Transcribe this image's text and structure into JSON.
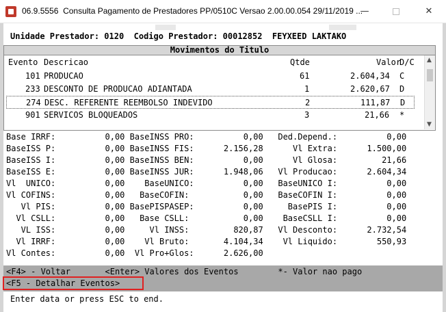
{
  "window": {
    "version": "06.9.5556",
    "title": "Consulta  Pagamento de Prestadores PP/0510C Versao 2.00.00.054 29/11/2019 ..."
  },
  "header": {
    "line": "Unidade Prestador: 0120  Codigo Prestador: 00012852  FEYXEED LAKTAKO"
  },
  "movements": {
    "title": "Movimentos do Titulo",
    "columns": {
      "evento": "Evento",
      "descricao": "Descricao",
      "qtde": "Qtde",
      "valor": "Valor",
      "dc": "D/C"
    },
    "rows": [
      {
        "evento": "101",
        "descricao": "PRODUCAO",
        "qtde": "61",
        "valor": "2.604,34",
        "dc": "C"
      },
      {
        "evento": "233",
        "descricao": "DESCONTO DE PRODUCAO ADIANTADA",
        "qtde": "1",
        "valor": "2.620,67",
        "dc": "D"
      },
      {
        "evento": "274",
        "descricao": "DESC. REFERENTE REEMBOLSO INDEVIDO",
        "qtde": "2",
        "valor": "111,87",
        "dc": "D"
      },
      {
        "evento": "901",
        "descricao": "SERVICOS BLOQUEADOS",
        "qtde": "3",
        "valor": "21,66",
        "dc": "*"
      }
    ]
  },
  "totals": [
    "Base IRRF:          0,00 BaseINSS PRO:          0,00   Ded.Depend.:          0,00",
    "BaseISS P:          0,00 BaseINSS FIS:      2.156,28      Vl Extra:      1.500,00",
    "BaseISS I:          0,00 BaseINSS BEN:          0,00      Vl Glosa:         21,66",
    "BaseISS E:          0,00 BaseINSS JUR:      1.948,06   Vl Producao:      2.604,34",
    "Vl  UNICO:          0,00    BaseUNICO:          0,00   BaseUNICO I:          0,00",
    "Vl COFINS:          0,00   BaseCOFIN:           0,00   BaseCOFIN I:          0,00",
    "   Vl PIS:          0,00 BasePISPASEP:          0,00     BasePIS I:          0,00",
    "  Vl CSLL:          0,00   Base CSLL:           0,00    BaseCSLL I:          0,00",
    "   VL ISS:          0,00     Vl INSS:         820,87   Vl Desconto:      2.732,54",
    "  Vl IRRF:          0,00    Vl Bruto:       4.104,34    Vl Liquido:        550,93",
    "Vl Contes:          0,00  Vl Pro+Glos:      2.626,00"
  ],
  "fkeys": {
    "line1": "<F4> - Voltar       <Enter> Valores dos Eventos        *- Valor nao pago",
    "line2": "<F5 - Detalhar Eventos>"
  },
  "status": "Enter data or press ESC to end."
}
